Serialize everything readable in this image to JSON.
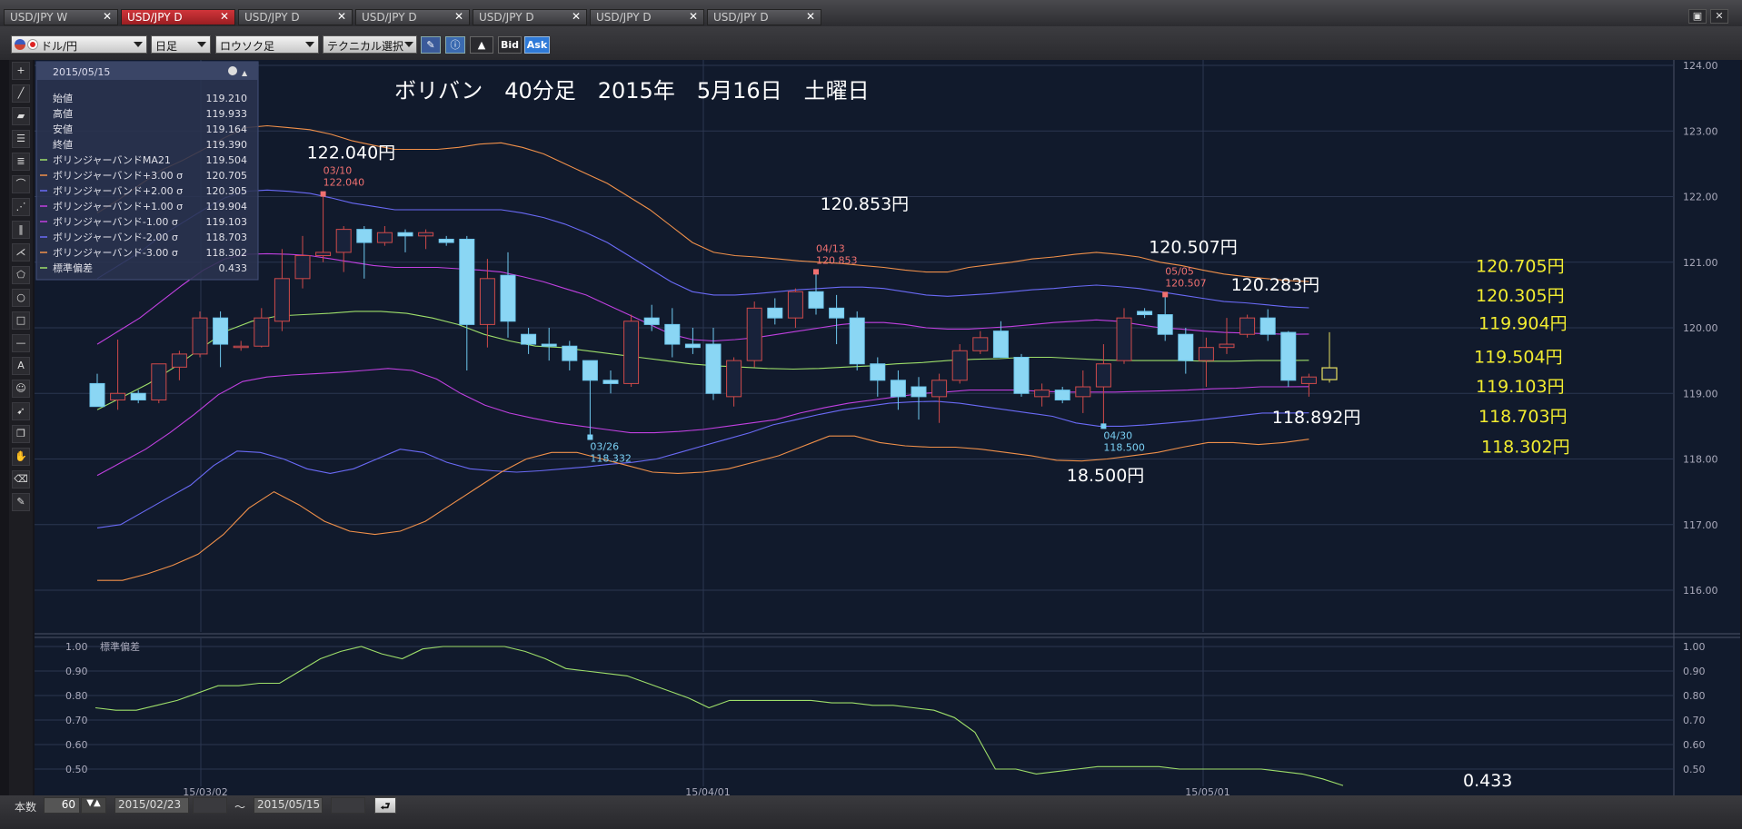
{
  "tabs": [
    "USD/JPY W",
    "USD/JPY D",
    "USD/JPY D",
    "USD/JPY D",
    "USD/JPY D",
    "USD/JPY D",
    "USD/JPY D"
  ],
  "active_tab": 1,
  "toolbar": {
    "currency": "ドル/円",
    "period": "日足",
    "chart_style": "ロウソク足",
    "technical": "テクニカル選択",
    "bid": "Bid",
    "ask": "Ask"
  },
  "info_panel": {
    "date": "2015/05/15",
    "rows": [
      {
        "label": "始値",
        "value": "119.210",
        "color": ""
      },
      {
        "label": "高値",
        "value": "119.933",
        "color": ""
      },
      {
        "label": "安値",
        "value": "119.164",
        "color": ""
      },
      {
        "label": "終値",
        "value": "119.390",
        "color": ""
      },
      {
        "label": "ボリンジャーバンドMA21",
        "value": "119.504",
        "color": "#9edf6a"
      },
      {
        "label": "ボリンジャーバンド+3.00 σ",
        "value": "120.705",
        "color": "#f0904a"
      },
      {
        "label": "ボリンジャーバンド+2.00 σ",
        "value": "120.305",
        "color": "#6a6af6"
      },
      {
        "label": "ボリンジャーバンド+1.00 σ",
        "value": "119.904",
        "color": "#c040e0"
      },
      {
        "label": "ボリンジャーバンド-1.00 σ",
        "value": "119.103",
        "color": "#c040e0"
      },
      {
        "label": "ボリンジャーバンド-2.00 σ",
        "value": "118.703",
        "color": "#6a6af6"
      },
      {
        "label": "ボリンジャーバンド-3.00 σ",
        "value": "118.302",
        "color": "#f0904a"
      },
      {
        "label": "標準偏差",
        "value": "0.433",
        "color": "#9edf6a"
      }
    ]
  },
  "chart_data": {
    "type": "candlestick",
    "title": "ボリバン　40分足　2015年　5月16日　土曜日",
    "y_ticks": [
      "124.00",
      "123.00",
      "122.00",
      "121.00",
      "120.00",
      "119.00",
      "118.00",
      "117.00",
      "116.00"
    ],
    "ylim": [
      115.6,
      124.0
    ],
    "x_ticks": [
      "15/03/02",
      "15/04/01",
      "15/05/01"
    ],
    "candles": [
      {
        "o": 119.15,
        "h": 119.3,
        "l": 118.8,
        "c": 118.8
      },
      {
        "o": 118.9,
        "h": 119.82,
        "l": 118.75,
        "c": 119.0
      },
      {
        "o": 119.0,
        "h": 119.05,
        "l": 118.85,
        "c": 118.9
      },
      {
        "o": 118.9,
        "h": 119.45,
        "l": 118.85,
        "c": 119.45
      },
      {
        "o": 119.4,
        "h": 119.65,
        "l": 119.2,
        "c": 119.6
      },
      {
        "o": 119.6,
        "h": 120.25,
        "l": 119.55,
        "c": 120.15
      },
      {
        "o": 120.15,
        "h": 120.25,
        "l": 119.4,
        "c": 119.75
      },
      {
        "o": 119.7,
        "h": 119.8,
        "l": 119.65,
        "c": 119.72
      },
      {
        "o": 119.72,
        "h": 120.3,
        "l": 119.7,
        "c": 120.15
      },
      {
        "o": 120.1,
        "h": 121.2,
        "l": 119.95,
        "c": 120.75
      },
      {
        "o": 120.75,
        "h": 121.4,
        "l": 120.6,
        "c": 121.1
      },
      {
        "o": 121.1,
        "h": 122.04,
        "l": 121.0,
        "c": 121.15
      },
      {
        "o": 121.15,
        "h": 121.55,
        "l": 120.85,
        "c": 121.5
      },
      {
        "o": 121.5,
        "h": 121.55,
        "l": 120.75,
        "c": 121.3
      },
      {
        "o": 121.3,
        "h": 121.55,
        "l": 121.25,
        "c": 121.45
      },
      {
        "o": 121.45,
        "h": 121.5,
        "l": 121.15,
        "c": 121.4
      },
      {
        "o": 121.4,
        "h": 121.5,
        "l": 121.2,
        "c": 121.45
      },
      {
        "o": 121.35,
        "h": 121.4,
        "l": 121.25,
        "c": 121.3
      },
      {
        "o": 121.35,
        "h": 121.4,
        "l": 119.35,
        "c": 120.05
      },
      {
        "o": 120.05,
        "h": 121.05,
        "l": 119.7,
        "c": 120.75
      },
      {
        "o": 120.8,
        "h": 121.15,
        "l": 119.85,
        "c": 120.1
      },
      {
        "o": 119.9,
        "h": 120.0,
        "l": 119.6,
        "c": 119.75
      },
      {
        "o": 119.75,
        "h": 120.0,
        "l": 119.5,
        "c": 119.72
      },
      {
        "o": 119.72,
        "h": 119.8,
        "l": 119.35,
        "c": 119.5
      },
      {
        "o": 119.5,
        "h": 119.5,
        "l": 118.332,
        "c": 119.2
      },
      {
        "o": 119.2,
        "h": 119.35,
        "l": 119.0,
        "c": 119.15
      },
      {
        "o": 119.15,
        "h": 120.2,
        "l": 119.1,
        "c": 120.1
      },
      {
        "o": 120.15,
        "h": 120.35,
        "l": 119.95,
        "c": 120.05
      },
      {
        "o": 120.05,
        "h": 120.3,
        "l": 119.55,
        "c": 119.75
      },
      {
        "o": 119.75,
        "h": 120.0,
        "l": 119.6,
        "c": 119.7
      },
      {
        "o": 119.75,
        "h": 120.0,
        "l": 118.9,
        "c": 119.0
      },
      {
        "o": 118.95,
        "h": 119.55,
        "l": 118.8,
        "c": 119.5
      },
      {
        "o": 119.5,
        "h": 120.4,
        "l": 119.4,
        "c": 120.3
      },
      {
        "o": 120.3,
        "h": 120.45,
        "l": 120.05,
        "c": 120.15
      },
      {
        "o": 120.15,
        "h": 120.6,
        "l": 120.0,
        "c": 120.55
      },
      {
        "o": 120.55,
        "h": 120.853,
        "l": 120.2,
        "c": 120.3
      },
      {
        "o": 120.3,
        "h": 120.5,
        "l": 119.75,
        "c": 120.15
      },
      {
        "o": 120.15,
        "h": 120.25,
        "l": 119.35,
        "c": 119.45
      },
      {
        "o": 119.45,
        "h": 119.55,
        "l": 118.95,
        "c": 119.2
      },
      {
        "o": 119.2,
        "h": 119.35,
        "l": 118.75,
        "c": 118.95
      },
      {
        "o": 119.1,
        "h": 119.25,
        "l": 118.6,
        "c": 118.95
      },
      {
        "o": 118.95,
        "h": 119.3,
        "l": 118.55,
        "c": 119.2
      },
      {
        "o": 119.2,
        "h": 119.75,
        "l": 119.15,
        "c": 119.65
      },
      {
        "o": 119.65,
        "h": 119.95,
        "l": 119.6,
        "c": 119.85
      },
      {
        "o": 119.95,
        "h": 120.1,
        "l": 119.55,
        "c": 119.55
      },
      {
        "o": 119.55,
        "h": 119.6,
        "l": 118.95,
        "c": 119.0
      },
      {
        "o": 118.95,
        "h": 119.15,
        "l": 118.8,
        "c": 119.05
      },
      {
        "o": 119.05,
        "h": 119.1,
        "l": 118.85,
        "c": 118.9
      },
      {
        "o": 118.95,
        "h": 119.35,
        "l": 118.7,
        "c": 119.1
      },
      {
        "o": 119.1,
        "h": 119.75,
        "l": 118.5,
        "c": 119.45
      },
      {
        "o": 119.5,
        "h": 120.3,
        "l": 119.45,
        "c": 120.15
      },
      {
        "o": 120.25,
        "h": 120.3,
        "l": 120.15,
        "c": 120.2
      },
      {
        "o": 120.2,
        "h": 120.507,
        "l": 119.8,
        "c": 119.9
      },
      {
        "o": 119.9,
        "h": 120.0,
        "l": 119.3,
        "c": 119.5
      },
      {
        "o": 119.5,
        "h": 119.85,
        "l": 119.1,
        "c": 119.7
      },
      {
        "o": 119.7,
        "h": 120.15,
        "l": 119.6,
        "c": 119.75
      },
      {
        "o": 119.9,
        "h": 120.2,
        "l": 119.85,
        "c": 120.15
      },
      {
        "o": 120.15,
        "h": 120.283,
        "l": 119.8,
        "c": 119.9
      },
      {
        "o": 119.93,
        "h": 119.95,
        "l": 119.1,
        "c": 119.2
      },
      {
        "o": 119.15,
        "h": 119.3,
        "l": 118.95,
        "c": 119.25
      }
    ],
    "last_candle": {
      "o": 119.21,
      "h": 119.933,
      "l": 119.164,
      "c": 119.39
    },
    "bands": [
      {
        "name": "ボリンジャーバンド+3.00 σ",
        "color": "#f0904a",
        "values": [
          121.75,
          121.95,
          122.18,
          122.4,
          122.55,
          122.72,
          122.9,
          123.05,
          123.08,
          123.05,
          123.02,
          122.95,
          122.85,
          122.78,
          122.72,
          122.72,
          122.72,
          122.75,
          122.8,
          122.82,
          122.75,
          122.65,
          122.5,
          122.35,
          122.2,
          122.0,
          121.8,
          121.55,
          121.3,
          121.15,
          121.1,
          121.08,
          121.05,
          121.02,
          121.0,
          120.98,
          120.95,
          120.92,
          120.88,
          120.85,
          120.85,
          120.92,
          120.96,
          121.0,
          121.05,
          121.08,
          121.12,
          121.15,
          121.12,
          121.08,
          121.0,
          120.95,
          120.88,
          120.82,
          120.78,
          120.75,
          120.72,
          120.705
        ]
      },
      {
        "name": "ボリンジャーバンド+2.00 σ",
        "color": "#6a6af6",
        "values": [
          120.75,
          120.95,
          121.15,
          121.4,
          121.6,
          121.8,
          121.98,
          122.08,
          122.1,
          122.08,
          122.05,
          121.98,
          121.9,
          121.85,
          121.8,
          121.8,
          121.8,
          121.8,
          121.8,
          121.8,
          121.75,
          121.68,
          121.58,
          121.45,
          121.3,
          121.1,
          120.9,
          120.7,
          120.55,
          120.5,
          120.5,
          120.52,
          120.55,
          120.58,
          120.6,
          120.62,
          120.62,
          120.6,
          120.55,
          120.5,
          120.48,
          120.5,
          120.52,
          120.55,
          120.58,
          120.6,
          120.63,
          120.65,
          120.63,
          120.6,
          120.55,
          120.5,
          120.45,
          120.4,
          120.38,
          120.35,
          120.32,
          120.305
        ]
      },
      {
        "name": "ボリンジャーバンド+1.00 σ",
        "color": "#c040e0",
        "values": [
          119.75,
          119.95,
          120.15,
          120.4,
          120.65,
          120.88,
          121.05,
          121.12,
          121.13,
          121.12,
          121.1,
          121.05,
          121.0,
          120.95,
          120.92,
          120.92,
          120.92,
          120.9,
          120.88,
          120.85,
          120.78,
          120.7,
          120.6,
          120.5,
          120.35,
          120.2,
          120.05,
          119.9,
          119.82,
          119.8,
          119.82,
          119.85,
          119.9,
          119.95,
          120.0,
          120.05,
          120.08,
          120.08,
          120.05,
          120.0,
          119.98,
          119.98,
          120.0,
          120.02,
          120.05,
          120.08,
          120.1,
          120.12,
          120.1,
          120.05,
          120.0,
          119.98,
          119.95,
          119.93,
          119.92,
          119.91,
          119.9,
          119.904
        ]
      },
      {
        "name": "ボリンジャーバンドMA21",
        "color": "#9edf6a",
        "values": [
          118.75,
          118.95,
          119.15,
          119.4,
          119.68,
          119.95,
          120.1,
          120.18,
          120.2,
          120.22,
          120.25,
          120.25,
          120.22,
          120.15,
          120.05,
          119.9,
          119.8,
          119.72,
          119.7,
          119.65,
          119.6,
          119.55,
          119.5,
          119.45,
          119.42,
          119.4,
          119.38,
          119.37,
          119.38,
          119.4,
          119.42,
          119.45,
          119.47,
          119.5,
          119.52,
          119.53,
          119.55,
          119.55,
          119.53,
          119.51,
          119.5,
          119.5,
          119.5,
          119.49,
          119.49,
          119.5,
          119.5,
          119.504
        ]
      },
      {
        "name": "ボリンジャーバンド-1.00 σ",
        "color": "#c040e0",
        "values": [
          117.75,
          117.95,
          118.15,
          118.4,
          118.68,
          118.98,
          119.18,
          119.25,
          119.28,
          119.3,
          119.32,
          119.35,
          119.38,
          119.35,
          119.22,
          119.0,
          118.82,
          118.7,
          118.62,
          118.55,
          118.5,
          118.45,
          118.4,
          118.4,
          118.42,
          118.45,
          118.5,
          118.55,
          118.6,
          118.7,
          118.78,
          118.85,
          118.9,
          118.95,
          119.0,
          119.02,
          119.05,
          119.05,
          119.05,
          119.03,
          119.02,
          119.02,
          119.02,
          119.03,
          119.04,
          119.05,
          119.07,
          119.08,
          119.1,
          119.1,
          119.103
        ]
      },
      {
        "name": "ボリンジャーバンド-2.00 σ",
        "color": "#6a6af6",
        "values": [
          116.95,
          117.0,
          117.2,
          117.4,
          117.6,
          117.9,
          118.12,
          118.1,
          118.0,
          117.85,
          117.78,
          117.85,
          118.0,
          118.15,
          118.1,
          117.95,
          117.85,
          117.82,
          117.8,
          117.82,
          117.85,
          117.88,
          117.92,
          117.95,
          118.0,
          118.1,
          118.2,
          118.3,
          118.4,
          118.52,
          118.6,
          118.68,
          118.75,
          118.8,
          118.85,
          118.87,
          118.88,
          118.85,
          118.8,
          118.75,
          118.7,
          118.65,
          118.55,
          118.5,
          118.5,
          118.52,
          118.55,
          118.58,
          118.62,
          118.66,
          118.7,
          118.7,
          118.703
        ]
      },
      {
        "name": "ボリンジャーバンド-3.00 σ",
        "color": "#f0904a",
        "values": [
          116.15,
          116.15,
          116.25,
          116.38,
          116.55,
          116.85,
          117.25,
          117.5,
          117.3,
          117.05,
          116.9,
          116.85,
          116.9,
          117.05,
          117.3,
          117.55,
          117.8,
          118.0,
          118.1,
          118.1,
          118.0,
          117.9,
          117.8,
          117.78,
          117.8,
          117.85,
          117.95,
          118.05,
          118.2,
          118.35,
          118.35,
          118.25,
          118.2,
          118.18,
          118.18,
          118.15,
          118.1,
          118.05,
          117.98,
          117.97,
          118.0,
          118.05,
          118.1,
          118.18,
          118.25,
          118.25,
          118.22,
          118.25,
          118.302
        ]
      }
    ],
    "candle_labels": [
      {
        "idx": 11,
        "date": "03/10",
        "price": "122.040",
        "at": "high"
      },
      {
        "idx": 24,
        "date": "03/26",
        "price": "118.332",
        "at": "low"
      },
      {
        "idx": 35,
        "date": "04/13",
        "price": "120.853",
        "at": "high"
      },
      {
        "idx": 49,
        "date": "04/30",
        "price": "118.500",
        "at": "low"
      },
      {
        "idx": 52,
        "date": "05/05",
        "price": "120.507",
        "at": "high"
      }
    ],
    "annotations_white": [
      {
        "text": "122.040円",
        "price": 122.58,
        "idx": 11
      },
      {
        "text": "120.853円",
        "price": 121.8,
        "idx": 36
      },
      {
        "text": "120.507円",
        "price": 121.14,
        "idx": 52
      },
      {
        "text": "120.283円",
        "price": 120.57,
        "idx": 56
      },
      {
        "text": "118.892円",
        "price": 118.55,
        "idx": 58
      },
      {
        "text": "18.500円",
        "price": 117.66,
        "idx": 48
      }
    ],
    "annotations_yellow": [
      {
        "text": "120.705円",
        "price": 120.85
      },
      {
        "text": "120.305円",
        "price": 120.4
      },
      {
        "text": "119.904円",
        "price": 119.98
      },
      {
        "text": "119.504円",
        "price": 119.47
      },
      {
        "text": "119.103円",
        "price": 119.02
      },
      {
        "text": "118.703円",
        "price": 118.56
      },
      {
        "text": "118.302円",
        "price": 118.1
      }
    ],
    "stddev": {
      "label": "標準偏差",
      "y_ticks": [
        "1.00",
        "0.90",
        "0.80",
        "0.70",
        "0.60",
        "0.50"
      ],
      "ylim": [
        0.43,
        1.02
      ],
      "values": [
        0.75,
        0.74,
        0.74,
        0.76,
        0.78,
        0.81,
        0.84,
        0.84,
        0.85,
        0.85,
        0.9,
        0.95,
        0.98,
        1.0,
        0.97,
        0.95,
        0.99,
        1.0,
        1.0,
        1.0,
        1.0,
        0.98,
        0.95,
        0.91,
        0.9,
        0.89,
        0.88,
        0.85,
        0.82,
        0.79,
        0.75,
        0.78,
        0.78,
        0.78,
        0.78,
        0.78,
        0.77,
        0.77,
        0.76,
        0.76,
        0.75,
        0.74,
        0.71,
        0.65,
        0.5,
        0.5,
        0.48,
        0.49,
        0.5,
        0.51,
        0.51,
        0.51,
        0.51,
        0.5,
        0.5,
        0.5,
        0.5,
        0.5,
        0.49,
        0.48,
        0.46,
        0.433
      ],
      "last_value": "0.433"
    }
  },
  "bottom": {
    "count_label": "本数",
    "count_value": "60",
    "date_from": "2015/02/23",
    "tilde": "～",
    "date_to": "2015/05/15"
  }
}
